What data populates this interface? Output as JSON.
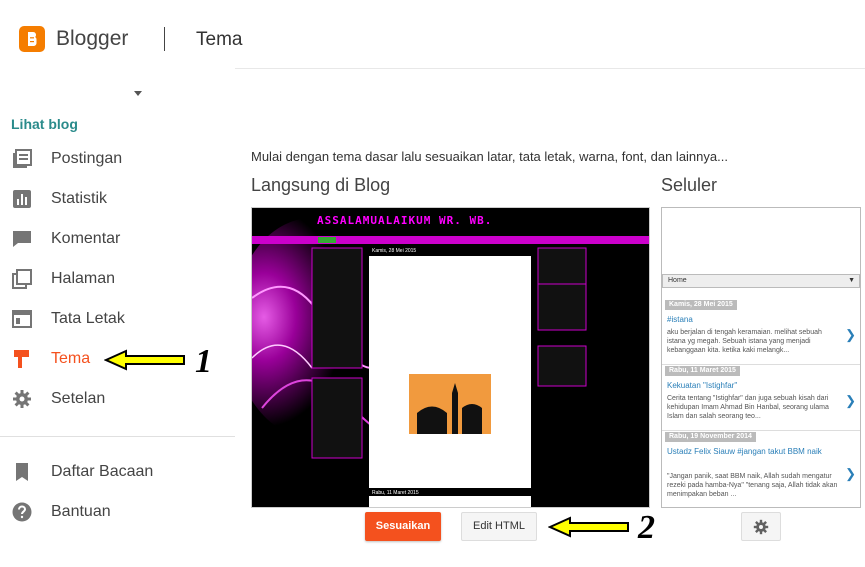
{
  "header": {
    "brand": "Blogger",
    "section": "Tema"
  },
  "sidebar": {
    "view_blog": "Lihat blog",
    "items": [
      {
        "label": "Postingan",
        "icon": "posts-icon"
      },
      {
        "label": "Statistik",
        "icon": "stats-icon"
      },
      {
        "label": "Komentar",
        "icon": "comment-icon"
      },
      {
        "label": "Halaman",
        "icon": "pages-icon"
      },
      {
        "label": "Tata Letak",
        "icon": "layout-icon"
      },
      {
        "label": "Tema",
        "icon": "theme-icon",
        "active": true
      },
      {
        "label": "Setelan",
        "icon": "gear-icon"
      },
      {
        "label": "Daftar Bacaan",
        "icon": "bookmark-icon"
      },
      {
        "label": "Bantuan",
        "icon": "help-icon"
      }
    ]
  },
  "annotations": {
    "one": "1",
    "two": "2"
  },
  "main": {
    "intro": "Mulai dengan tema dasar lalu sesuaikan latar, tata letak, warna, font, dan lainnya...",
    "live_title": "Langsung di Blog",
    "mobile_title": "Seluler",
    "customize_label": "Sesuaikan",
    "edit_html_label": "Edit HTML"
  },
  "desktop_preview": {
    "blog_title": "ASSALAMUALAIKUM WR. WB.",
    "post_date": "Kamis, 28 Mei 2015",
    "next_date": "Rabu, 11 Maret 2015"
  },
  "mobile_preview": {
    "nav_label": "Home",
    "posts": [
      {
        "date": "Kamis, 28 Mei 2015",
        "title": "#istana",
        "snippet": "aku berjalan di tengah keramaian. melihat sebuah istana yg megah. Sebuah istana yang menjadi kebanggaan kita. ketika kaki melangk..."
      },
      {
        "date": "Rabu, 11 Maret 2015",
        "title": "Kekuatan \"Istighfar\"",
        "snippet": "Cerita tentang \"Istighfar\" dan juga sebuah kisah dari kehidupan Imam Ahmad Bin Hanbal, seorang ulama Islam dan salah seorang teo..."
      },
      {
        "date": "Rabu, 19 November 2014",
        "title": "Ustadz Felix Siauw #jangan takut BBM naik",
        "snippet": "\"Jangan panik, saat BBM naik, Allah sudah mengatur rezeki pada hamba-Nya\" \"tenang saja, Allah tidak akan menimpakan beban ..."
      }
    ]
  },
  "colors": {
    "accent": "#f4511e",
    "link": "#2a8b8b",
    "magenta": "#c800c8",
    "arrow": "#ffff00"
  }
}
